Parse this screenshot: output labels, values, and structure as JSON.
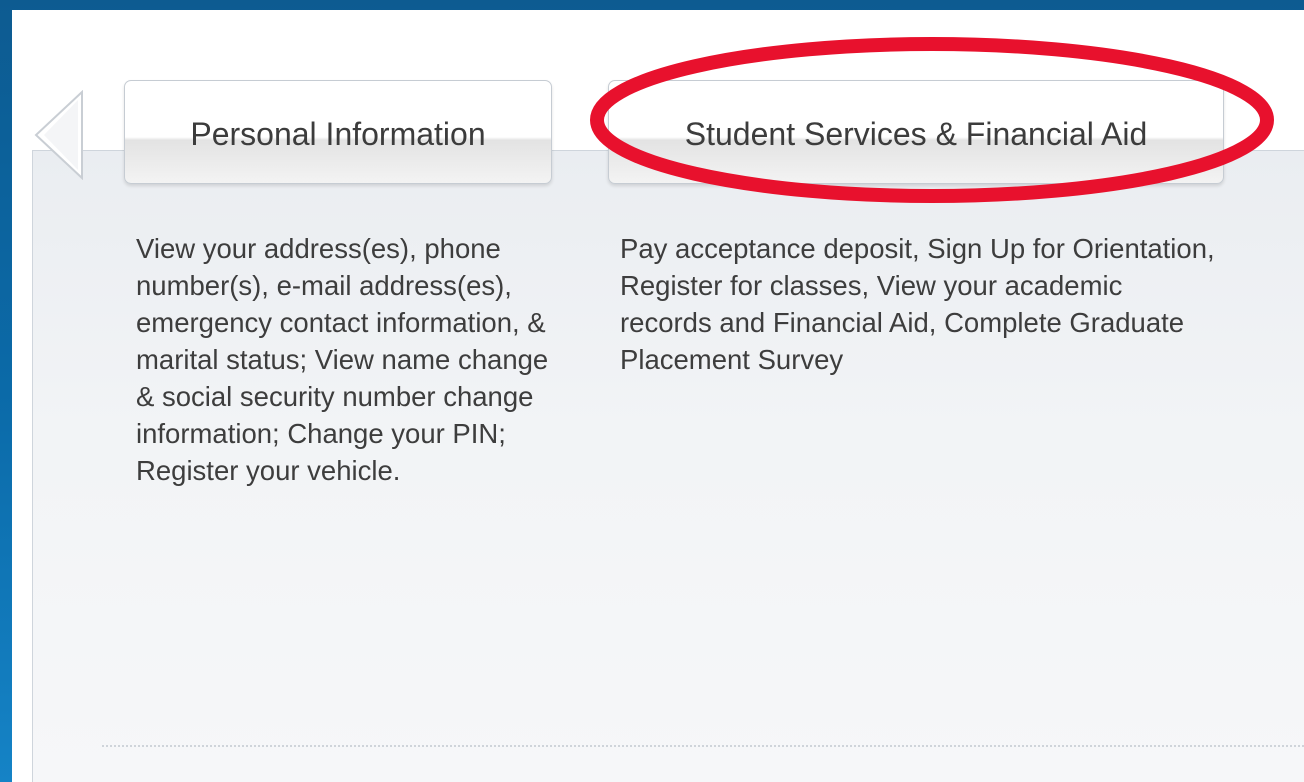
{
  "tabs": {
    "personal": {
      "label": "Personal Information",
      "description": "View your address(es), phone number(s), e-mail address(es), emergency contact information, & marital status; View name change & social security number change information; Change your PIN; Register your vehicle."
    },
    "student": {
      "label": "Student Services & Financial Aid",
      "description": "Pay acceptance deposit, Sign Up for Orientation, Register for classes, View your academic records and Financial Aid, Complete Graduate Placement Survey"
    }
  },
  "colors": {
    "outer_border": "#0b6aa8",
    "highlight": "#e8112d",
    "panel": "#eef1f4",
    "text": "#3d3d3d"
  },
  "icons": {
    "previous": "arrow-left-icon"
  }
}
